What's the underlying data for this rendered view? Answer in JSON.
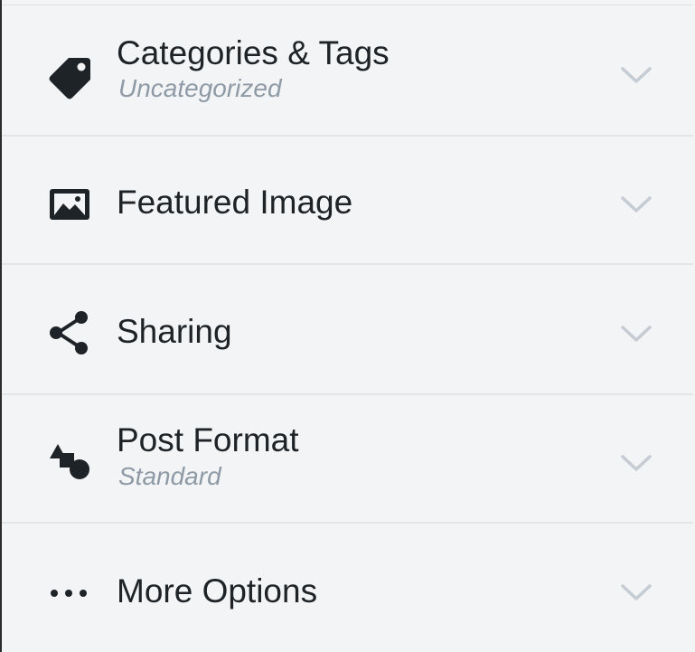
{
  "sections": [
    {
      "title": "Categories & Tags",
      "subtitle": "Uncategorized",
      "icon": "tag-icon"
    },
    {
      "title": "Featured Image",
      "icon": "image-icon"
    },
    {
      "title": "Sharing",
      "icon": "share-icon"
    },
    {
      "title": "Post Format",
      "subtitle": "Standard",
      "icon": "post-format-icon"
    },
    {
      "title": "More Options",
      "icon": "ellipsis-icon"
    }
  ],
  "colors": {
    "background": "#f3f4f5",
    "divider": "#e3e6e9",
    "title_text": "#1e2327",
    "subtitle_text": "#8e9aa5",
    "chevron": "#c5ccd3",
    "icon": "#1e2327"
  }
}
